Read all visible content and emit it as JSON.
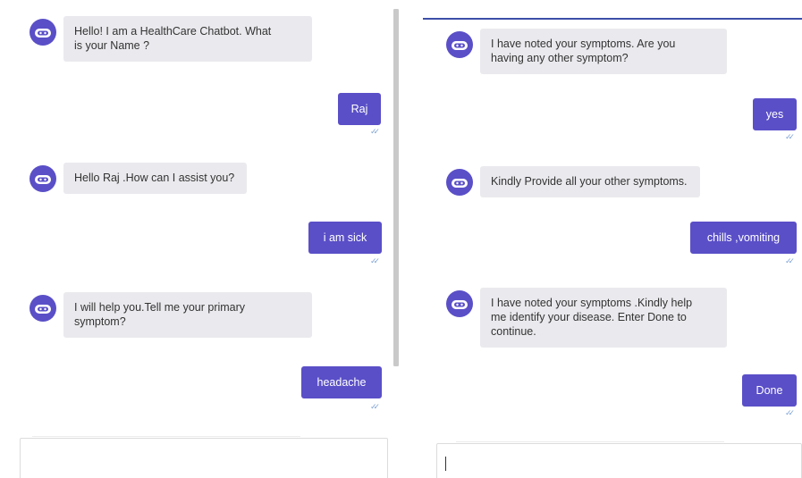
{
  "left": {
    "messages": [
      {
        "from": "bot",
        "text": "Hello! I am a HealthCare Chatbot. What\nis your Name ?"
      },
      {
        "from": "user",
        "text": "Raj"
      },
      {
        "from": "bot",
        "text": "Hello Raj .How can I assist you?"
      },
      {
        "from": "user",
        "text": "i am sick"
      },
      {
        "from": "bot",
        "text": "I will help you.Tell me your primary\nsymptom?"
      },
      {
        "from": "user",
        "text": "headache"
      }
    ]
  },
  "right": {
    "messages": [
      {
        "from": "bot",
        "text": "I have noted your symptoms. Are you\nhaving any other symptom?"
      },
      {
        "from": "user",
        "text": "yes"
      },
      {
        "from": "bot",
        "text": "Kindly Provide all your other symptoms."
      },
      {
        "from": "user",
        "text": "chills ,vomiting"
      },
      {
        "from": "bot",
        "text": "I have noted your symptoms .Kindly help\nme identify your disease. Enter Done to\ncontinue."
      },
      {
        "from": "user",
        "text": "Done"
      }
    ]
  },
  "read_ticks": "✓✓",
  "colors": {
    "user_bubble": "#5a4fc7",
    "bot_bubble": "#eaeaee",
    "avatar": "#5a4fc7",
    "tick": "#7fa3d6"
  },
  "icons": {
    "bot_avatar": "robot-head-icon",
    "read_receipt": "double-check-icon"
  }
}
